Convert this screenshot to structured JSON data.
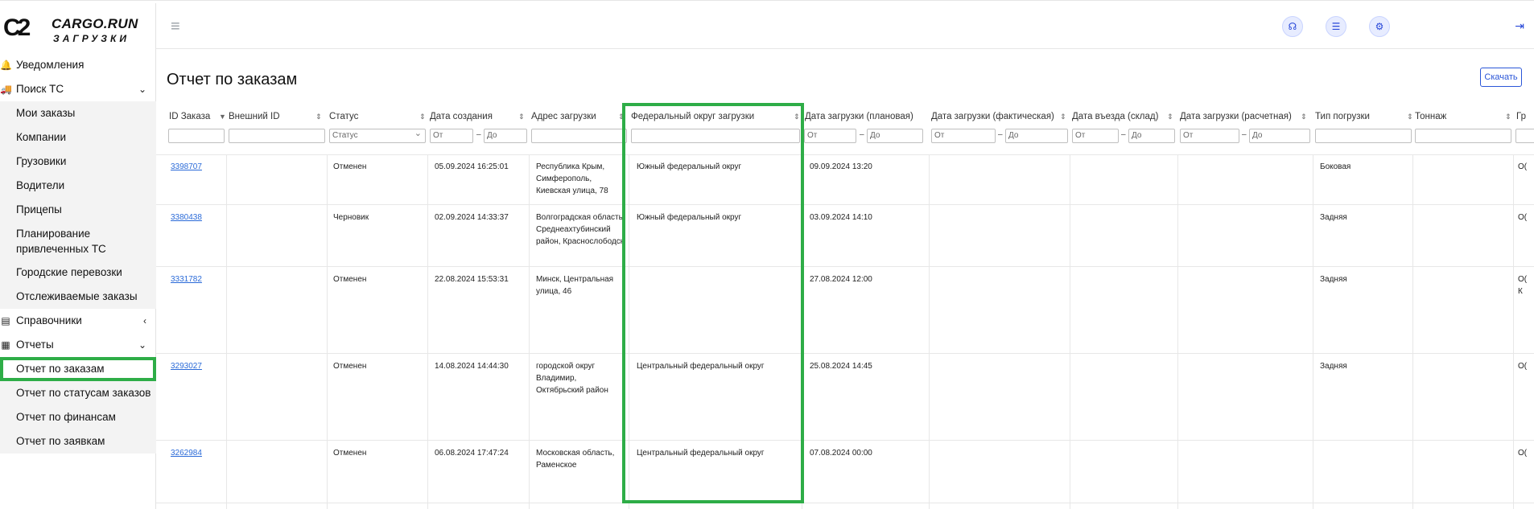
{
  "logo": {
    "mark": "C2",
    "brand": "CARGO.RUN",
    "sub": "ЗАГРУЗКИ"
  },
  "nav": {
    "notifications": "Уведомления",
    "search_ts": "Поиск ТС",
    "search_children": [
      "Мои заказы",
      "Компании",
      "Грузовики",
      "Водители",
      "Прицепы",
      "Планирование привлеченных ТС",
      "Городские перевозки",
      "Отслеживаемые заказы"
    ],
    "references": "Справочники",
    "reports": "Отчеты",
    "report_children": [
      "Отчет по заказам",
      "Отчет по статусам заказов",
      "Отчет по финансам",
      "Отчет по заявкам"
    ]
  },
  "page": {
    "title": "Отчет по заказам",
    "download_label": "Скачать"
  },
  "table": {
    "headers": [
      "ID Заказа",
      "Внешний ID",
      "Статус",
      "Дата создания",
      "Адрес загрузки",
      "Федеральный округ загрузки",
      "Дата загрузки (плановая)",
      "Дата загрузки (фактическая)",
      "Дата въезда (склад)",
      "Дата загрузки (расчетная)",
      "Тип погрузки",
      "Тоннаж",
      "Гр"
    ],
    "filters": {
      "status_placeholder": "Статус",
      "from": "От",
      "to": "До"
    },
    "rows": [
      {
        "id": "3398707",
        "status": "Отменен",
        "created": "05.09.2024 16:25:01",
        "address": "Республика Крым, Симферополь, Киевская улица, 78",
        "district": "Южный федеральный округ",
        "planned": "09.09.2024 13:20",
        "load_type": "Боковая",
        "extra": "О("
      },
      {
        "id": "3380438",
        "status": "Черновик",
        "created": "02.09.2024 14:33:37",
        "address": "Волгоградская область, Среднеахтубинский район, Краснослободск",
        "district": "Южный федеральный округ",
        "planned": "03.09.2024 14:10",
        "load_type": "Задняя",
        "extra": "О("
      },
      {
        "id": "3331782",
        "status": "Отменен",
        "created": "22.08.2024 15:53:31",
        "address": "Минск, Центральная улица, 46",
        "district": "",
        "planned": "27.08.2024 12:00",
        "load_type": "Задняя",
        "extra": "О( К"
      },
      {
        "id": "3293027",
        "status": "Отменен",
        "created": "14.08.2024 14:44:30",
        "address": "городской округ Владимир, Октябрьский район",
        "district": "Центральный федеральный округ",
        "planned": "25.08.2024 14:45",
        "load_type": "Задняя",
        "extra": "О("
      },
      {
        "id": "3262984",
        "status": "Отменен",
        "created": "06.08.2024 17:47:24",
        "address": "Московская область, Раменское",
        "district": "Центральный федеральный округ",
        "planned": "07.08.2024 00:00",
        "load_type": "",
        "extra": "О("
      }
    ]
  },
  "icons": {
    "hamburger": "≡",
    "headset": "☊",
    "list": "☰",
    "user": "⚙",
    "logout": "⇥"
  }
}
